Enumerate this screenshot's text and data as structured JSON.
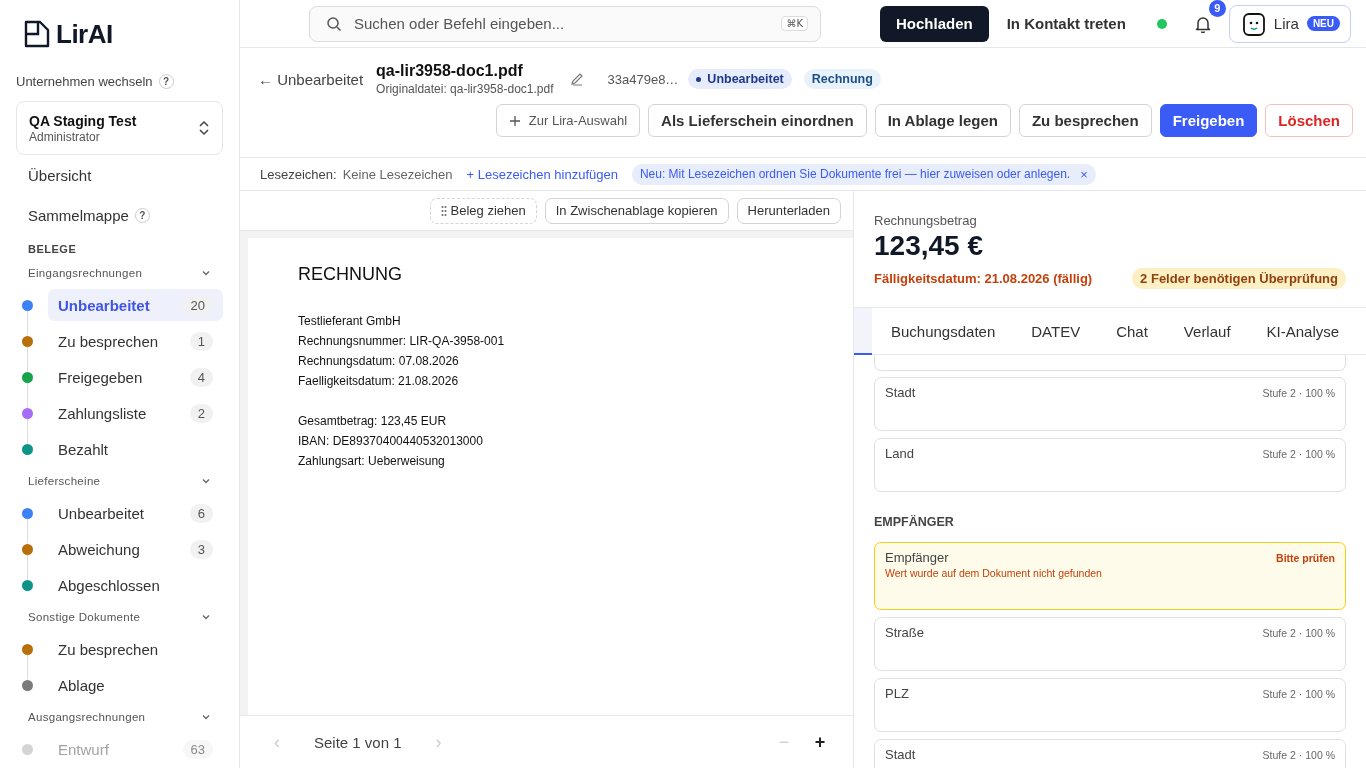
{
  "sidebar": {
    "logo": "LirAI",
    "company_switch_label": "Unternehmen wechseln",
    "company_switch_help": "?",
    "company": {
      "name": "QA Staging Test",
      "role": "Administrator"
    },
    "nav": [
      {
        "label": "Übersicht"
      },
      {
        "label": "Sammelmappe",
        "help": "?"
      }
    ],
    "section": "BELEGE",
    "groups": [
      {
        "title": "Eingangsrechnungen",
        "expanded": true,
        "items": [
          {
            "label": "Unbearbeitet",
            "count": "20",
            "color": "#3b82f6",
            "selected": true,
            "faded": false
          },
          {
            "label": "Zu besprechen",
            "count": "1",
            "color": "#b86e0a",
            "selected": false,
            "faded": false
          },
          {
            "label": "Freigegeben",
            "count": "4",
            "color": "#16a34a",
            "selected": false,
            "faded": false
          },
          {
            "label": "Zahlungsliste",
            "count": "2",
            "color": "#a66cf5",
            "selected": false,
            "faded": false
          },
          {
            "label": "Bezahlt",
            "color": "#0d9488",
            "selected": false,
            "faded": false
          }
        ]
      },
      {
        "title": "Lieferscheine",
        "expanded": true,
        "items": [
          {
            "label": "Unbearbeitet",
            "count": "6",
            "color": "#3b82f6",
            "selected": false,
            "faded": false
          },
          {
            "label": "Abweichung",
            "count": "3",
            "color": "#b86e0a",
            "selected": false,
            "faded": false
          },
          {
            "label": "Abgeschlossen",
            "color": "#0d9488",
            "selected": false,
            "faded": false
          }
        ]
      },
      {
        "title": "Sonstige Dokumente",
        "expanded": true,
        "items": [
          {
            "label": "Zu besprechen",
            "color": "#b86e0a",
            "selected": false,
            "faded": false
          },
          {
            "label": "Ablage",
            "color": "#7a7a7a",
            "selected": false,
            "faded": false
          }
        ]
      },
      {
        "title": "Ausgangsrechnungen",
        "expanded": true,
        "items": [
          {
            "label": "Entwurf",
            "count": "63",
            "color": "#d4d4d4",
            "selected": false,
            "faded": true
          }
        ]
      }
    ]
  },
  "topbar": {
    "search": {
      "placeholder": "Suchen oder Befehl eingeben...",
      "shortcut": "⌘K"
    },
    "upload": "Hochladen",
    "contact": "In Kontakt treten",
    "online": true,
    "notifications": "9",
    "assistant": {
      "label": "Lira",
      "badge": "NEU"
    }
  },
  "document": {
    "back": "← Unbearbeitet",
    "filename": "qa-lir3958-doc1.pdf",
    "original": "Originaldatei: qa-lir3958-doc1.pdf",
    "hash": "33a479e8…",
    "status": "Unbearbeitet",
    "type": "Rechnung",
    "actions": [
      {
        "label": "Zur Lira-Auswahl",
        "kind": "add"
      },
      {
        "label": "Als Lieferschein einordnen",
        "kind": "default"
      },
      {
        "label": "In Ablage legen",
        "kind": "default"
      },
      {
        "label": "Zu besprechen",
        "kind": "default"
      },
      {
        "label": "Freigeben",
        "kind": "primary"
      },
      {
        "label": "Löschen",
        "kind": "danger"
      }
    ]
  },
  "bookmarks": {
    "label": "Lesezeichen:",
    "value": "Keine Lesezeichen",
    "add": "+ Lesezeichen hinzufügen",
    "notice": "Neu: Mit Lesezeichen ordnen Sie Dokumente frei — hier zuweisen oder anlegen.",
    "notice_close": "×"
  },
  "viewer": {
    "tools": [
      {
        "label": "Beleg ziehen",
        "kind": "drag"
      },
      {
        "label": "In Zwischenablage kopieren",
        "kind": "default"
      },
      {
        "label": "Herunterladen",
        "kind": "default"
      }
    ],
    "page": {
      "title": "RECHNUNG",
      "blocks": [
        [
          "Testlieferant GmbH",
          "Rechnungsnummer: LIR-QA-3958-001",
          "Rechnungsdatum: 07.08.2026",
          "Faelligkeitsdatum: 21.08.2026"
        ],
        [
          "Gesamtbetrag: 123,45 EUR",
          "IBAN: DE89370400440532013000",
          "Zahlungsart: Ueberweisung"
        ]
      ]
    },
    "pager": {
      "prev": "‹",
      "prev_disabled": true,
      "text": "Seite 1 von 1",
      "next": "›",
      "next_disabled": true,
      "zoom_out": "−",
      "zoom_out_disabled": true,
      "zoom_in": "+",
      "zoom_in_disabled": false
    }
  },
  "details": {
    "amount_label": "Rechnungsbetrag",
    "amount": "123,45 €",
    "due": "Fälligkeitsdatum: 21.08.2026 (fällig)",
    "review_badge": "2 Felder benötigen Überprüfung",
    "tabs": [
      {
        "label": "Buchungsdaten",
        "selected": false
      },
      {
        "label": "DATEV",
        "selected": false
      },
      {
        "label": "Chat",
        "selected": false
      },
      {
        "label": "Verlauf",
        "selected": false
      },
      {
        "label": "KI-Analyse",
        "selected": false
      }
    ],
    "sections": [
      {
        "fields": [
          {
            "label": "Stadt",
            "kind": "normal",
            "meta": "Stufe 2 · 100 %"
          },
          {
            "label": "Land",
            "kind": "normal",
            "meta": "Stufe 2 · 100 %"
          }
        ]
      },
      {
        "title": "EMPFÄNGER",
        "fields": [
          {
            "label": "Empfänger",
            "kind": "review",
            "meta": "Bitte prüfen",
            "message": "Wert wurde auf dem Dokument nicht gefunden"
          },
          {
            "label": "Straße",
            "kind": "normal",
            "meta": "Stufe 2 · 100 %"
          },
          {
            "label": "PLZ",
            "kind": "normal",
            "meta": "Stufe 2 · 100 %"
          },
          {
            "label": "Stadt",
            "kind": "normal",
            "meta": "Stufe 2 · 100 %"
          }
        ]
      }
    ]
  }
}
